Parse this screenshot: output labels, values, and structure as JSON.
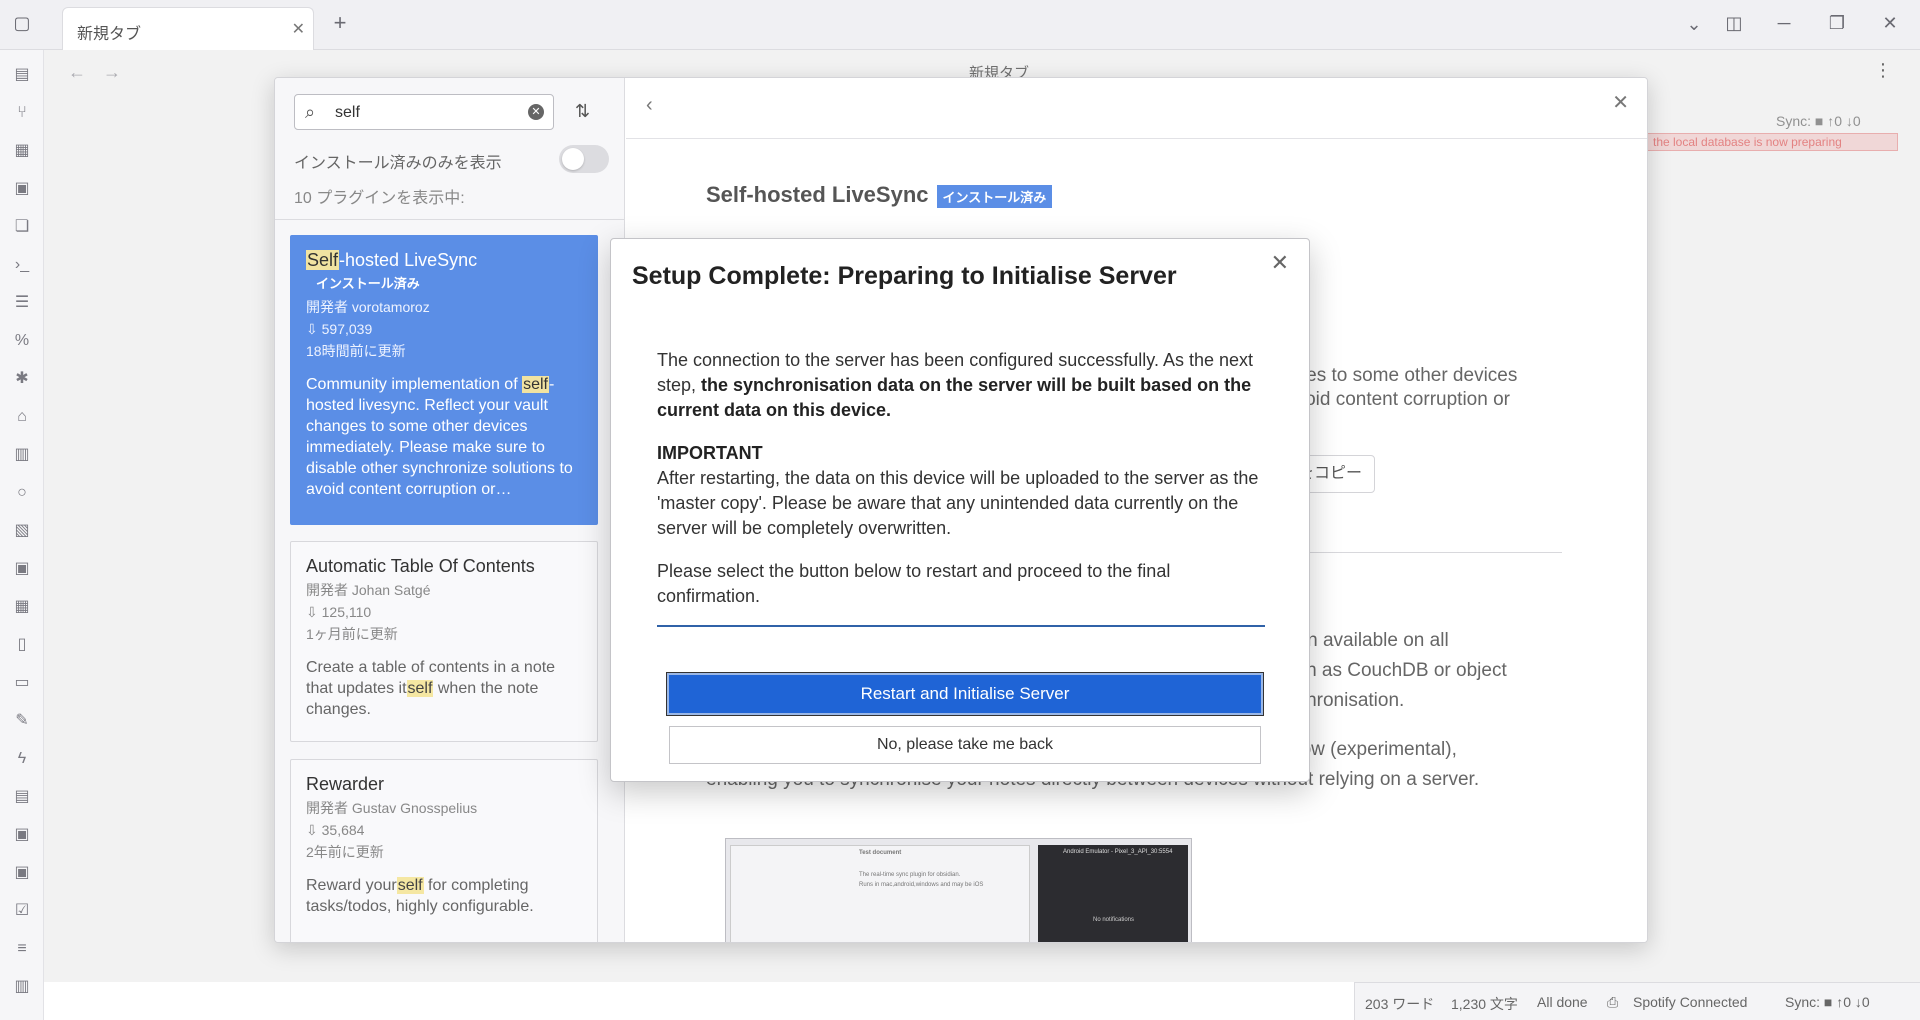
{
  "window": {
    "tab_title": "新規タブ",
    "tab_close": "✕",
    "new_tab": "+",
    "view_title": "新規タブ"
  },
  "sync_top": "Sync: ■ ↑0 ↓0",
  "warn_strip": "the local database is now preparing",
  "statusbar": {
    "words": "203 ワード",
    "chars": "1,230 文字",
    "status": "All done",
    "spotify": "Spotify Connected",
    "sync": "Sync: ■ ↑0 ↓0"
  },
  "plugin_browser": {
    "search": {
      "value": "self"
    },
    "toggle_label": "インストール済みのみを表示",
    "toggle_on": false,
    "count_label": "10 プラグインを表示中:",
    "plugins": [
      {
        "name_hl": "Self",
        "name_rest": "-hosted LiveSync",
        "badge": "インストール済み",
        "author": "開発者 vorotamoroz",
        "downloads": "597,039",
        "updated": "18時間前に更新",
        "desc_pre": "Community implementation of ",
        "desc_hl": "self",
        "desc_post": "-hosted livesync. Reflect your vault changes to some other devices immediately. Please make sure to disable other synchronize solutions to avoid content corruption or…"
      },
      {
        "name": "Automatic Table Of Contents",
        "author": "開発者 Johan Satgé",
        "downloads": "125,110",
        "updated": "1ヶ月前に更新",
        "desc_pre": "Create a table of contents in a note that updates it",
        "desc_hl": "self",
        "desc_post": " when the note changes."
      },
      {
        "name": "Rewarder",
        "author": "開発者 Gustav Gnosspelius",
        "downloads": "35,684",
        "updated": "2年前に更新",
        "desc_pre": "Reward your",
        "desc_hl": "self",
        "desc_post": " for completing tasks/todos, highly configurable."
      }
    ],
    "detail": {
      "title": "Self-hosted LiveSync",
      "badge": "インストール済み",
      "line1": "nges to some other devices",
      "line2": "avoid content corruption or",
      "copy_button": "をコピー",
      "line3": "g-in available on all",
      "line4": "uch as CouchDB or object",
      "line5": "nchronisation.",
      "line6": "now (experimental),",
      "line7": "enabling you to synchronise your notes directly between devices without relying on a server.",
      "ss_title": "Test document",
      "ss_line1": "The real-time sync plugin for obsidian.",
      "ss_line2": "Runs in mac,android,windows and may be iOS",
      "ss_right_title": "Android Emulator - Pixel_3_API_30:5554",
      "ss_right_sub": "No notifications"
    }
  },
  "dialog": {
    "title": "Setup Complete: Preparing to Initialise Server",
    "close": "✕",
    "p1_pre": "The connection to the server has been configured successfully. As the next step, ",
    "p1_bold": "the synchronisation data on the server will be built based on the current data on this device.",
    "important": "IMPORTANT",
    "p2": "After restarting, the data on this device will be uploaded to the server as the 'master copy'. Please be aware that any unintended data currently on the server will be completely overwritten.",
    "p3": "Please select the button below to restart and proceed to the final confirmation.",
    "primary_button": "Restart and Initialise Server",
    "secondary_button": "No, please take me back"
  }
}
